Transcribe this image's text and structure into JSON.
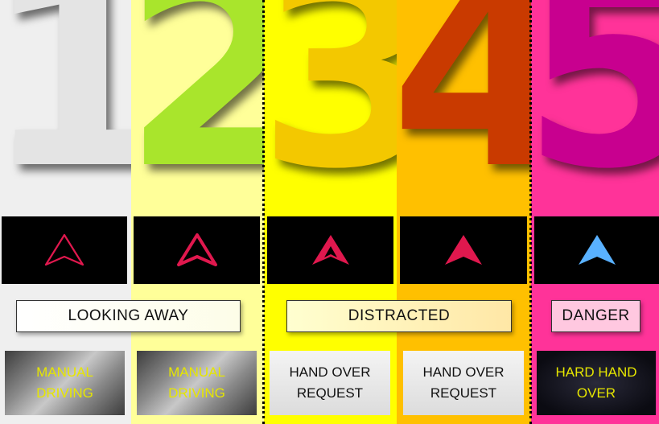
{
  "columns": [
    {
      "digit": "1",
      "bg": "#efefef",
      "digit_color": "#e6e6e6",
      "icon": "hollow-triangle-icon",
      "icon_color": "#e0184e"
    },
    {
      "digit": "2",
      "bg": "#ffff99",
      "digit_color": "#a9e52c",
      "icon": "arrow-triangle-icon",
      "icon_color": "#e0184e"
    },
    {
      "digit": "3",
      "bg": "#ffff00",
      "digit_color": "#f3c800",
      "icon": "arrow-triangle-icon",
      "icon_color": "#e0184e"
    },
    {
      "digit": "4",
      "bg": "#ffc000",
      "digit_color": "#c93a00",
      "icon": "arrow-triangle-icon",
      "icon_color": "#e0184e"
    },
    {
      "digit": "5",
      "bg": "#ff3399",
      "digit_color": "#c8008f",
      "icon": "arrow-triangle-icon",
      "icon_color": "#59b1ff"
    }
  ],
  "labels": {
    "looking_away": "LOOKING AWAY",
    "distracted": "DISTRACTED",
    "danger": "DANGER"
  },
  "cards": {
    "c1": "MANUAL\nDRIVING",
    "c2": "MANUAL\nDRIVING",
    "c3": "HAND OVER\nREQUEST",
    "c4": "HAND OVER\nREQUEST",
    "c5": "HARD HAND\nOVER"
  }
}
